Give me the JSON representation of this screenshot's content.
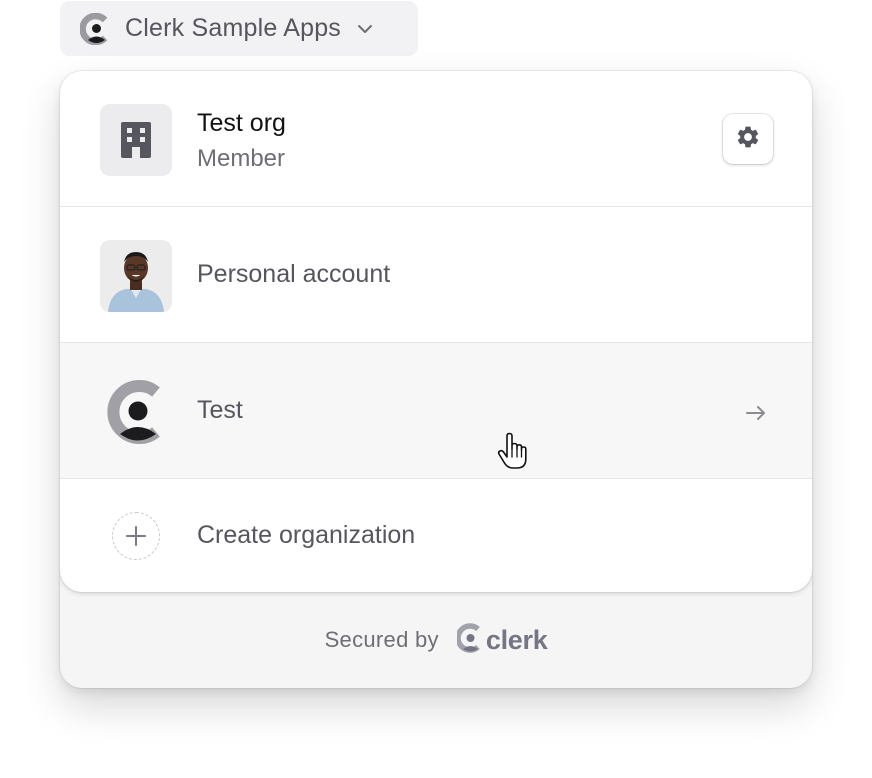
{
  "switcher": {
    "label": "Clerk Sample Apps",
    "logo_icon": "clerk-logo-icon",
    "chevron_icon": "chevron-down-icon"
  },
  "active_org": {
    "name": "Test org",
    "role": "Member",
    "avatar_icon": "building-icon",
    "settings_icon": "gear-icon"
  },
  "list": {
    "personal_label": "Personal account",
    "org_label": "Test",
    "org_arrow_icon": "arrow-right-icon",
    "create_label": "Create organization",
    "create_icon": "plus-icon"
  },
  "footer": {
    "secured_label": "Secured by",
    "brand_label": "clerk"
  },
  "colors": {
    "text_primary": "#131316",
    "text_secondary": "#55565e",
    "hover_row": "#f7f7f8",
    "footer_bg": "#f5f5f5"
  }
}
